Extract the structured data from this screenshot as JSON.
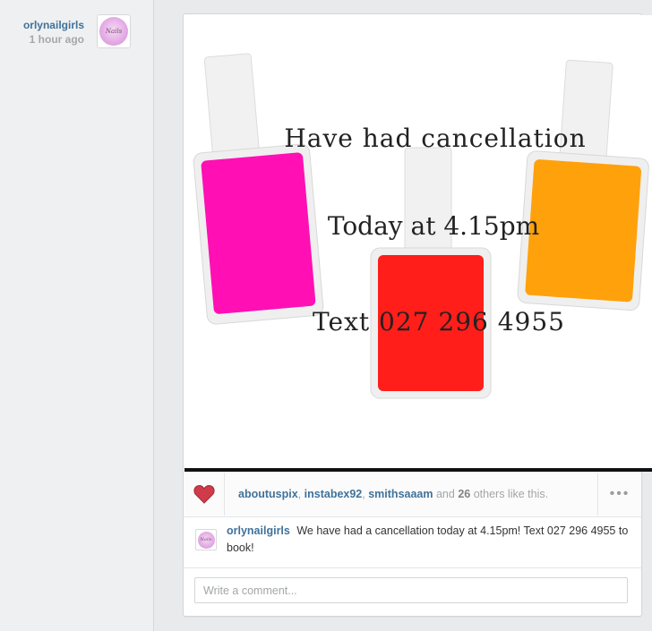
{
  "post": {
    "username": "orlynailgirls",
    "time_ago": "1 hour ago",
    "avatar_text": "Nails"
  },
  "photo": {
    "lines": [
      "Have had cancellation",
      "Today at 4.15pm",
      "Text 027 296 4955"
    ],
    "bottle_colors": [
      "#ff0fb4",
      "#ff1e1a",
      "#ffa10a"
    ]
  },
  "likes": {
    "users": [
      "aboutuspix",
      "instabex92",
      "smithsaaam"
    ],
    "separator": ",",
    "and_text": "and",
    "count": "26",
    "suffix": "others like this.",
    "heart_color": "#d03b4a",
    "more_icon": "•••"
  },
  "caption": {
    "username": "orlynailgirls",
    "text": "We have had a cancellation today at 4.15pm! Text 027 296 4955 to book!"
  },
  "comment": {
    "placeholder": "Write a comment..."
  }
}
